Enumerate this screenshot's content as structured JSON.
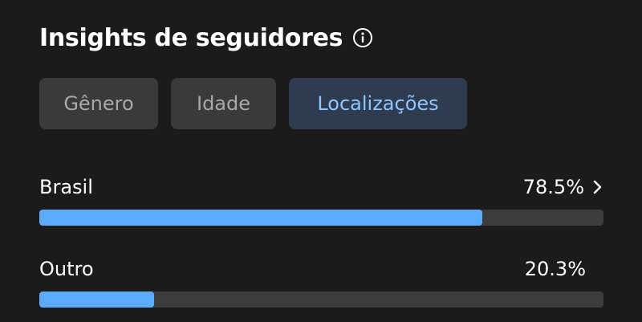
{
  "header": {
    "title": "Insights de seguidores",
    "info_icon": "info-icon"
  },
  "tabs": [
    {
      "label": "Gênero",
      "selected": false
    },
    {
      "label": "Idade",
      "selected": false
    },
    {
      "label": "Localizações",
      "selected": true
    }
  ],
  "locations": [
    {
      "label": "Brasil",
      "value_text": "78.5%",
      "fraction": 0.785,
      "has_chevron": true
    },
    {
      "label": "Outro",
      "value_text": "20.3%",
      "fraction": 0.203,
      "has_chevron": false
    }
  ],
  "colors": {
    "background": "#1b1b1b",
    "tab_bg": "#3a3a3a",
    "tab_selected_bg": "#2f3b4e",
    "tab_selected_text": "#8ec5ff",
    "bar_track": "#3c3c3c",
    "bar_fill": "#5cabff"
  }
}
